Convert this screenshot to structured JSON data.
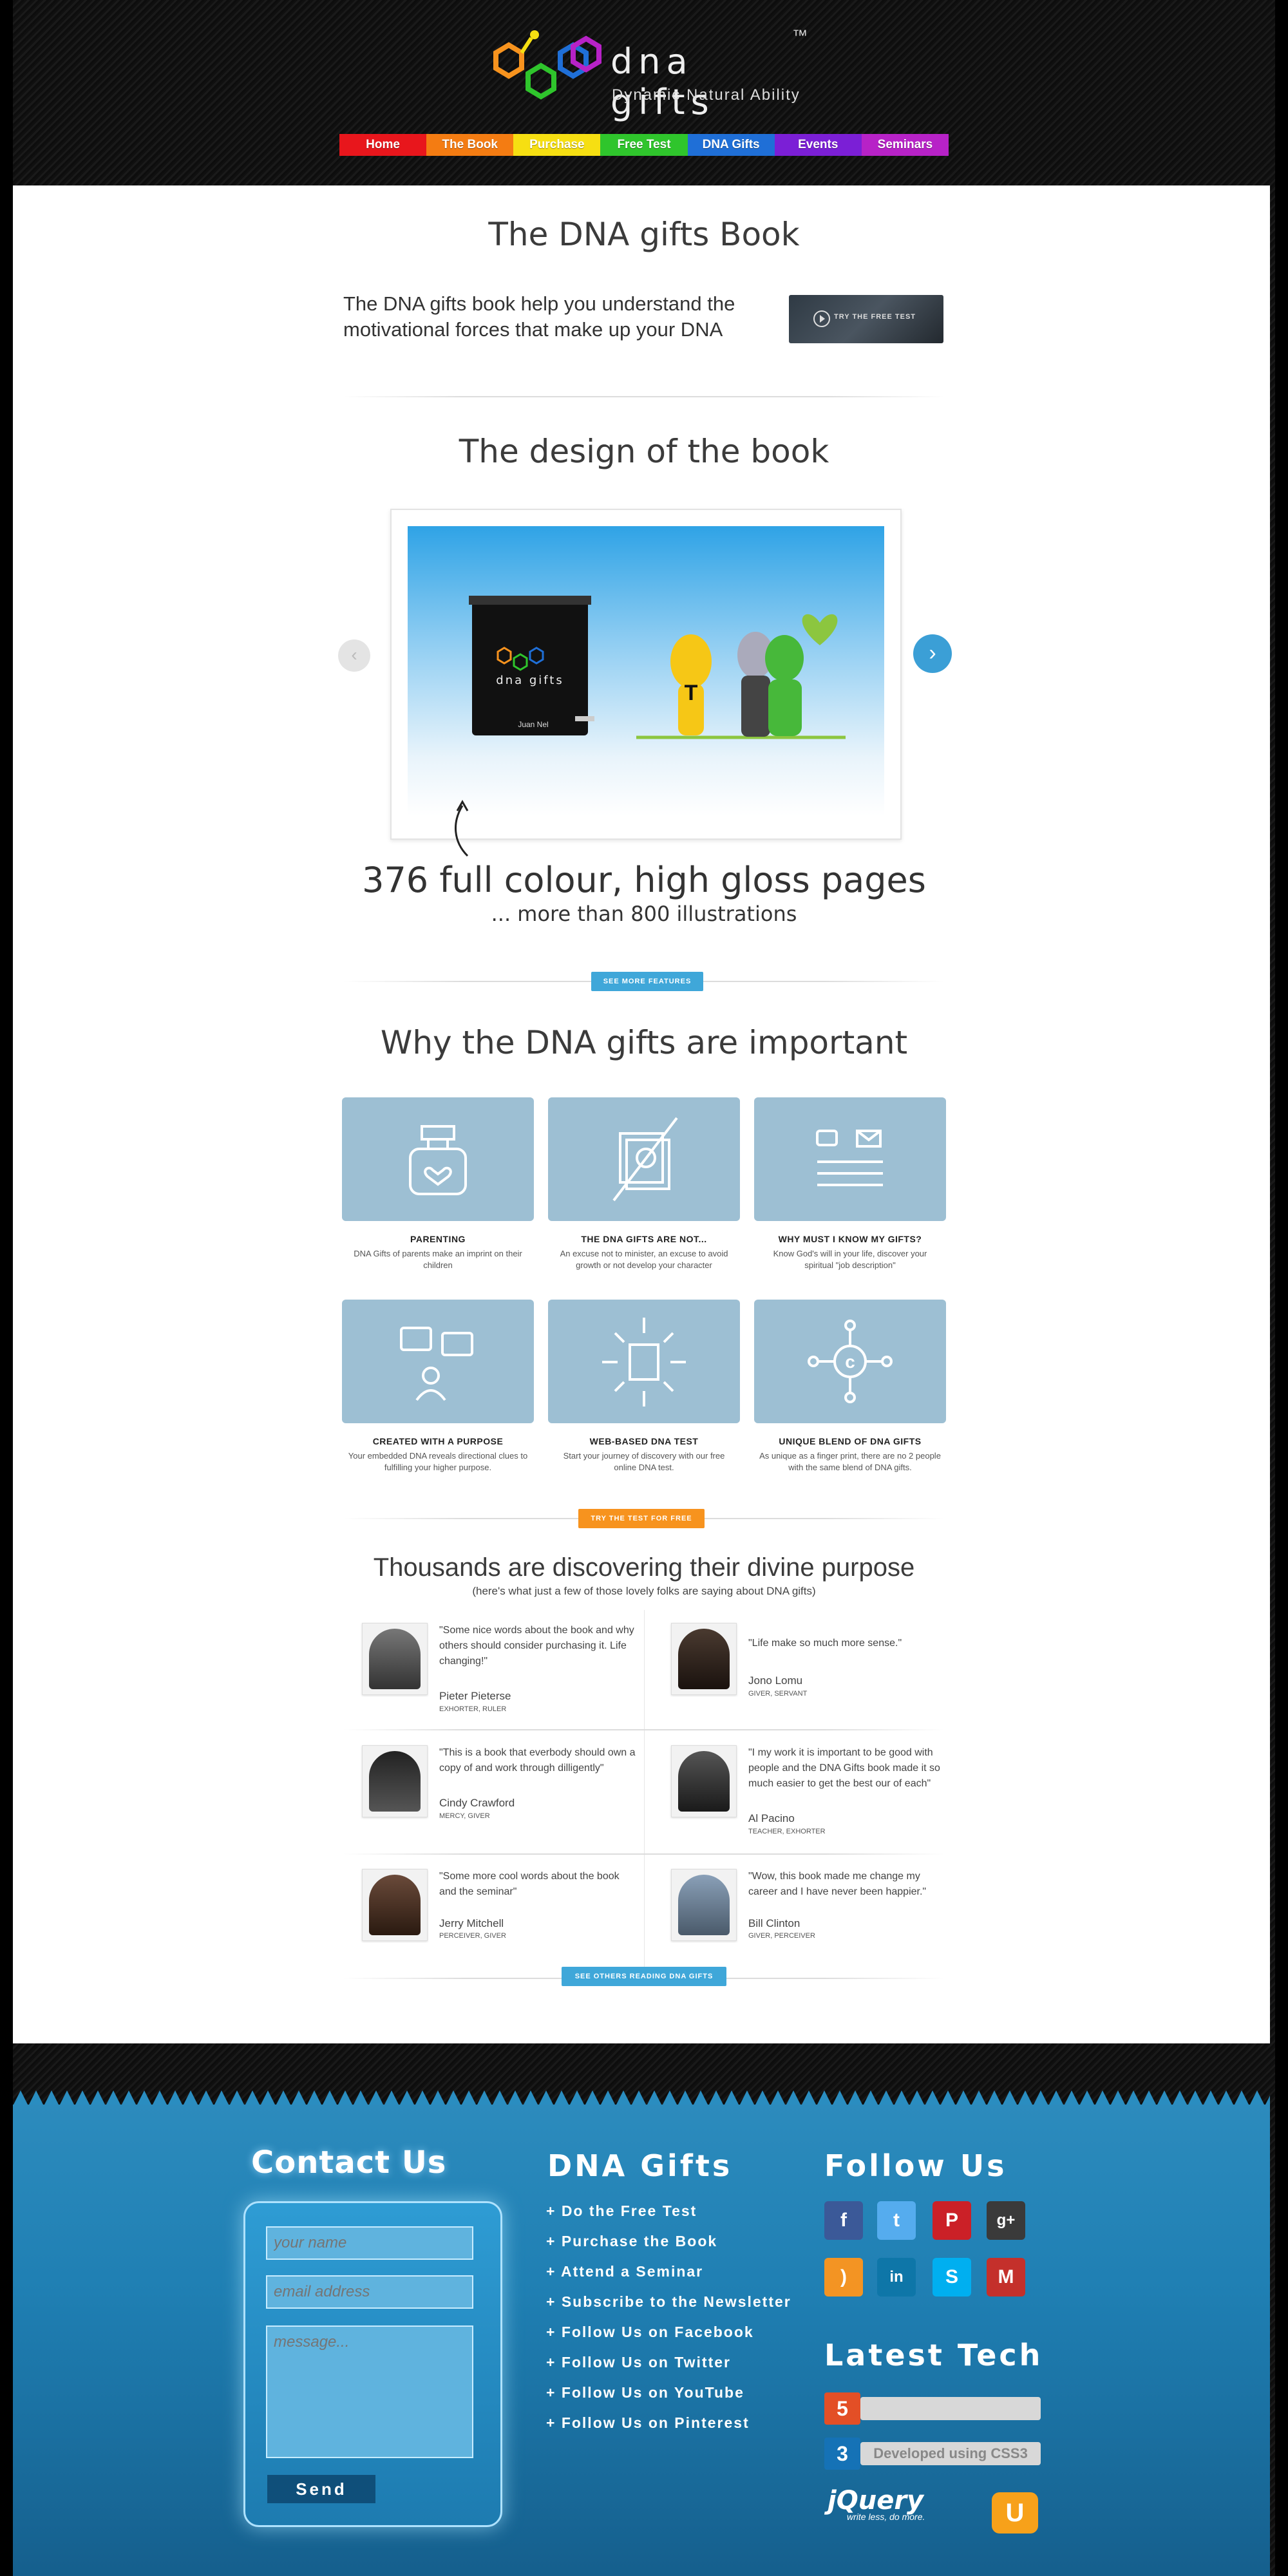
{
  "brand": {
    "name": "dna gifts",
    "tm": "™",
    "tagline": "Dynamic Natural Ability"
  },
  "nav": [
    {
      "label": "Home",
      "color": "#e8161c"
    },
    {
      "label": "The Book",
      "color": "#f47c12"
    },
    {
      "label": "Purchase",
      "color": "#f6df12"
    },
    {
      "label": "Free Test",
      "color": "#2fc52c"
    },
    {
      "label": "DNA Gifts",
      "color": "#1f6fd7"
    },
    {
      "label": "Events",
      "color": "#7b1fd6"
    },
    {
      "label": "Seminars",
      "color": "#b722c7"
    }
  ],
  "book_section": {
    "title": "The DNA gifts Book",
    "intro": "The DNA gifts book help you understand the motivational forces that make up your DNA",
    "video_label": "TRY THE FREE TEST"
  },
  "design_section": {
    "title": "The design of the book",
    "slide_book_title": "dna gifts",
    "slide_book_author": "Juan Nel",
    "pages_headline": "376 full colour, high gloss pages",
    "pages_sub": "... more than 800 illustrations",
    "see_more_label": "SEE MORE FEATURES"
  },
  "why_section": {
    "title": "Why the DNA gifts are important",
    "features": [
      {
        "title": "PARENTING",
        "desc": "DNA Gifts of parents make an imprint on their children",
        "icon": "baby-bottle-icon"
      },
      {
        "title": "THE DNA GIFTS ARE NOT...",
        "desc": "An excuse not to minister, an excuse to avoid growth or not develop your character",
        "icon": "no-documents-icon"
      },
      {
        "title": "WHY MUST I KNOW MY GIFTS?",
        "desc": "Know God's will in your life, discover your spiritual \"job description\"",
        "icon": "message-icon"
      },
      {
        "title": "CREATED WITH A PURPOSE",
        "desc": "Your embedded DNA reveals directional clues to fulfilling your higher purpose.",
        "icon": "person-chat-icon"
      },
      {
        "title": "WEB-BASED DNA TEST",
        "desc": "Start your journey of discovery with our free online DNA test.",
        "icon": "document-burst-icon"
      },
      {
        "title": "UNIQUE BLEND OF DNA GIFTS",
        "desc": "As unique as a finger print, there are no 2 people with the same blend of DNA gifts.",
        "icon": "copyright-network-icon"
      }
    ],
    "cta_label": "TRY THE TEST FOR FREE",
    "cta_color": "#f7931e"
  },
  "testimonials_section": {
    "title": "Thousands are discovering their divine purpose",
    "subtitle": "(here's what just a few of those lovely folks are saying about DNA gifts)",
    "items": [
      {
        "quote": "\"Some nice words about the book and why others should consider purchasing it. Life changing!\"",
        "name": "Pieter Pieterse",
        "role": "EXHORTER, RULER"
      },
      {
        "quote": "\"Life make so much more sense.\"",
        "name": "Jono Lomu",
        "role": "GIVER, SERVANT"
      },
      {
        "quote": "\"This is a book that everbody should own a copy of and work through dilligently\"",
        "name": "Cindy Crawford",
        "role": "MERCY, GIVER"
      },
      {
        "quote": "\"I my work it is important to be good with people and the DNA Gifts book made it so much easier to get the best our of each\"",
        "name": "Al Pacino",
        "role": "TEACHER, EXHORTER"
      },
      {
        "quote": "\"Some more cool words about the book and the seminar\"",
        "name": "Jerry Mitchell",
        "role": "PERCEIVER, GIVER"
      },
      {
        "quote": "\"Wow, this book made me change my career and I have never been happier.\"",
        "name": "Bill Clinton",
        "role": "GIVER, PERCEIVER"
      }
    ],
    "see_others_label": "SEE OTHERS READING DNA GIFTS"
  },
  "footer": {
    "contact": {
      "title": "Contact Us",
      "name_placeholder": "your name",
      "email_placeholder": "email address",
      "message_placeholder": "message...",
      "send_label": "Send"
    },
    "links": {
      "title": "DNA Gifts",
      "items": [
        "+ Do the Free Test",
        "+ Purchase the Book",
        "+ Attend a Seminar",
        "+ Subscribe to the Newsletter",
        "+ Follow Us on Facebook",
        "+ Follow Us on Twitter",
        "+ Follow Us on YouTube",
        "+ Follow Us on Pinterest"
      ]
    },
    "follow": {
      "title": "Follow Us",
      "icons": [
        {
          "name": "facebook-icon",
          "glyph": "f",
          "color": "#3b5998"
        },
        {
          "name": "twitter-icon",
          "glyph": "t",
          "color": "#55acee"
        },
        {
          "name": "pinterest-icon",
          "glyph": "P",
          "color": "#cb2027"
        },
        {
          "name": "google-plus-icon",
          "glyph": "g+",
          "color": "#3a3a3a"
        },
        {
          "name": "rss-icon",
          "glyph": ")",
          "color": "#f39423"
        },
        {
          "name": "linkedin-icon",
          "glyph": "in",
          "color": "#0e76a8"
        },
        {
          "name": "skype-icon",
          "glyph": "S",
          "color": "#00aff0"
        },
        {
          "name": "gmail-icon",
          "glyph": "M",
          "color": "#c4302b"
        }
      ]
    },
    "tech": {
      "title": "Latest Tech",
      "css3_label": "Developed using CSS3",
      "jquery_label": "jQuery",
      "jquery_tag": "write less, do more."
    }
  }
}
